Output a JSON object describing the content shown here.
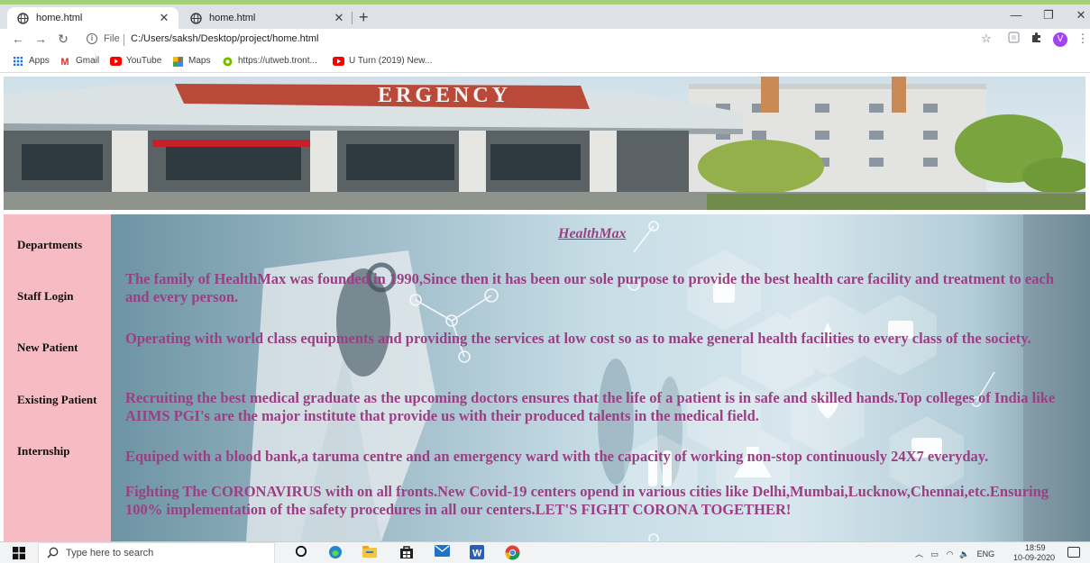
{
  "browser": {
    "tabs": [
      {
        "title": "home.html",
        "active": true
      },
      {
        "title": "home.html",
        "active": false
      }
    ],
    "new_tab_label": "+",
    "file_label": "File",
    "url": "C:/Users/saksh/Desktop/project/home.html",
    "profile_initial": "V",
    "bookmarks": [
      {
        "label": "Apps",
        "icon": "apps-grid-icon"
      },
      {
        "label": "Gmail",
        "icon": "gmail-icon"
      },
      {
        "label": "YouTube",
        "icon": "youtube-icon"
      },
      {
        "label": "Maps",
        "icon": "maps-icon"
      },
      {
        "label": "https://utweb.tront...",
        "icon": "utweb-icon"
      },
      {
        "label": "U Turn (2019) New...",
        "icon": "youtube-icon"
      }
    ]
  },
  "banner": {
    "sign_text": "ERGENCY"
  },
  "sidebar": {
    "items": [
      {
        "label": "Departments"
      },
      {
        "label": "Staff Login"
      },
      {
        "label": "New Patient"
      },
      {
        "label": "Existing Patient"
      },
      {
        "label": "Internship"
      }
    ]
  },
  "content": {
    "title": "HealthMax",
    "paragraphs": [
      "The family of HealthMax was founded in 1990,Since then it has been our sole purpose to provide the best health care facility and treatment to each and every person.",
      "Operating with world class equipments and providing the services at low cost so as to make general health facilities to every class of the society.",
      "Recruiting the best medical graduate as the upcoming doctors ensures that the life of a patient is in safe and skilled hands.Top colleges of India like AIIMS PGI's are the major institute that provide us with their produced talents in the medical field.",
      "Equiped with a blood bank,a taruma centre and an emergency ward with the capacity of working non-stop continuously 24X7 everyday.",
      "Fighting The CORONAVIRUS with on all fronts.New Covid-19 centers opend in various cities like Delhi,Mumbai,Lucknow,Chennai,etc.Ensuring 100% implementation of the safety procedures in all our centers.LET'S FIGHT CORONA TOGETHER!"
    ],
    "text_color": "#9b3f84"
  },
  "taskbar": {
    "search_placeholder": "Type here to search",
    "tray_language": "ENG",
    "clock_time": "18:59",
    "clock_date": "10-09-2020"
  }
}
